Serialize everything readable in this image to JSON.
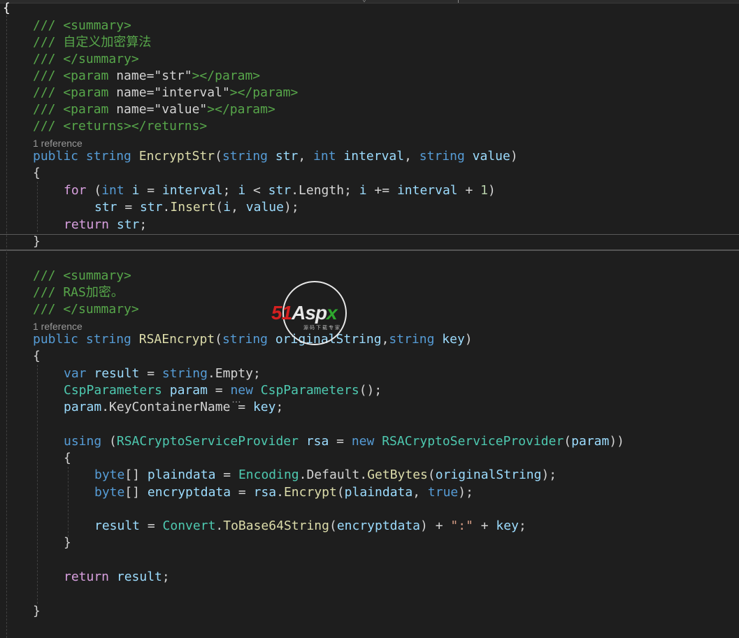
{
  "code": {
    "open_brace": "{",
    "block1": {
      "summary_open": "/// <summary>",
      "summary_text": "/// 自定义加密算法",
      "summary_close": "/// </summary>",
      "param1_pre": "/// <param ",
      "param1_attr": "name=",
      "param1_val": "\"str\"",
      "param1_post": "></param>",
      "param2_pre": "/// <param ",
      "param2_attr": "name=",
      "param2_val": "\"interval\"",
      "param2_post": "></param>",
      "param3_pre": "/// <param ",
      "param3_attr": "name=",
      "param3_val": "\"value\"",
      "param3_post": "></param>",
      "returns": "/// <returns></returns>",
      "references": "1 reference",
      "sig": {
        "public": "public",
        "string": "string",
        "name": "EncryptStr",
        "paren_open": "(",
        "t1": "string",
        "p1": "str",
        "comma1": ", ",
        "t2": "int",
        "p2": "interval",
        "comma2": ", ",
        "t3": "string",
        "p3": "value",
        "paren_close": ")"
      },
      "brace_open": "{",
      "for_line": {
        "for": "for",
        "paren": " (",
        "int": "int",
        "i1": "i",
        "eq": " = ",
        "interval1": "interval",
        "semi1": "; ",
        "i2": "i",
        "lt": " < ",
        "str": "str",
        "dot": ".",
        "length": "Length",
        "semi2": "; ",
        "i3": "i",
        "pluseq": " += ",
        "interval2": "interval",
        "plus": " + ",
        "one": "1",
        "close": ")"
      },
      "insert_line": {
        "str1": "str",
        "eq": " = ",
        "str2": "str",
        "dot": ".",
        "insert": "Insert",
        "open": "(",
        "i": "i",
        "comma": ", ",
        "value": "value",
        "close": ");"
      },
      "return_line": {
        "return": "return",
        "str": "str",
        "semi": ";"
      },
      "brace_close": "}"
    },
    "block2": {
      "summary_open": "/// <summary>",
      "summary_text": "/// RAS加密。",
      "summary_close": "/// </summary>",
      "references": "1 reference",
      "sig": {
        "public": "public",
        "string": "string",
        "name": "RSAEncrypt",
        "paren_open": "(",
        "t1": "string",
        "p1": "originalString",
        "comma": ",",
        "t2": "string",
        "p2": "key",
        "paren_close": ")"
      },
      "brace_open": "{",
      "var_line": {
        "var": "var",
        "result": "result",
        "eq": " = ",
        "string": "string",
        "dot": ".",
        "empty": "Empty",
        "semi": ";"
      },
      "csp_line": {
        "type": "CspParameters",
        "param": "param",
        "eq": " = ",
        "new": "new",
        "type2": "CspParameters",
        "tail": "();"
      },
      "key_line": {
        "param": "param",
        "dot": ".",
        "prop": "KeyContainerName",
        "eq": " = ",
        "key": "key",
        "semi": ";"
      },
      "using_line": {
        "using": "using",
        "paren": " (",
        "type": "RSACryptoServiceProvider",
        "rsa": "rsa",
        "eq": " = ",
        "new": "new",
        "type2": "RSACryptoServiceProvider",
        "open": "(",
        "param": "param",
        "close": "))"
      },
      "inner_open": "{",
      "plain_line": {
        "byte": "byte",
        "arr": "[] ",
        "name": "plaindata",
        "eq": " = ",
        "enc": "Encoding",
        "dot1": ".",
        "def": "Default",
        "dot2": ".",
        "fn": "GetBytes",
        "open": "(",
        "arg": "originalString",
        "close": ");"
      },
      "encrypt_line": {
        "byte": "byte",
        "arr": "[] ",
        "name": "encryptdata",
        "eq": " = ",
        "rsa": "rsa",
        "dot": ".",
        "fn": "Encrypt",
        "open": "(",
        "arg": "plaindata",
        "comma": ", ",
        "true": "true",
        "close": ");"
      },
      "result_line": {
        "result": "result",
        "eq": " = ",
        "convert": "Convert",
        "dot": ".",
        "fn": "ToBase64String",
        "open": "(",
        "arg": "encryptdata",
        "close": ")",
        "plus1": " + ",
        "str": "\":\"",
        "plus2": " + ",
        "key": "key",
        "semi": ";"
      },
      "inner_close": "}",
      "return_line": {
        "return": "return",
        "result": "result",
        "semi": ";"
      },
      "brace_close": "}"
    }
  },
  "watermark": {
    "num": "51",
    "asp": "Asp",
    "x": "x",
    "sub": "源码下载专家"
  },
  "colors": {
    "background": "#1e1e1e",
    "comment": "#57a64a",
    "keyword": "#569cd6",
    "control": "#d8a0df",
    "type": "#4ec9b0",
    "method": "#dcdcaa",
    "identifier": "#9cdcfe",
    "string": "#d69d85",
    "number": "#b5cea8"
  }
}
